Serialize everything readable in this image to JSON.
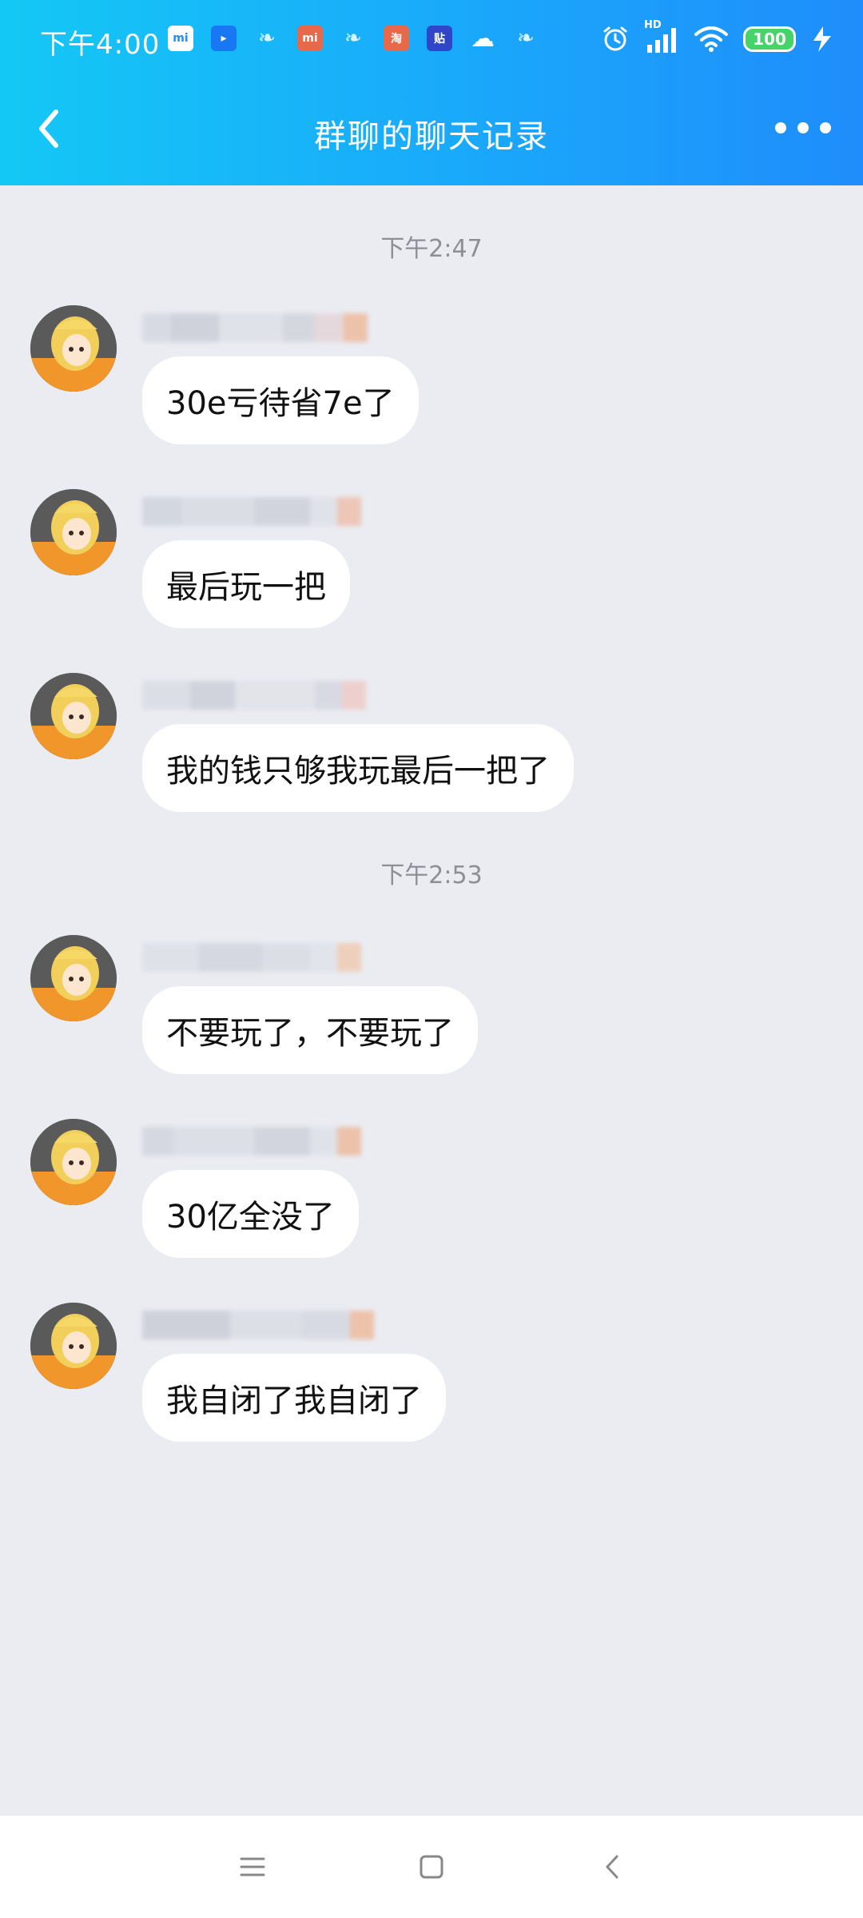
{
  "status_bar": {
    "time": "下午4:00",
    "app_icons": [
      {
        "name": "mi-store-icon",
        "label": "mi"
      },
      {
        "name": "bilibili-icon",
        "label": "▸"
      },
      {
        "name": "leaf-icon-1",
        "label": "❧"
      },
      {
        "name": "mi-app-icon",
        "label": "mi"
      },
      {
        "name": "leaf-icon-2",
        "label": "❧"
      },
      {
        "name": "taobao-icon",
        "label": "淘"
      },
      {
        "name": "tieba-icon",
        "label": "贴"
      },
      {
        "name": "cloud-icon",
        "label": "☁"
      },
      {
        "name": "leaf-icon-3",
        "label": "❧"
      }
    ],
    "network_label": "HD",
    "battery_level": "100"
  },
  "header": {
    "title": "群聊的聊天记录"
  },
  "chat": {
    "groups": [
      {
        "timestamp": "下午2:47",
        "messages": [
          {
            "text": "30e亏待省7e了"
          },
          {
            "text": "最后玩一把"
          },
          {
            "text": "我的钱只够我玩最后一把了"
          }
        ]
      },
      {
        "timestamp": "下午2:53",
        "messages": [
          {
            "text": "不要玩了，不要玩了"
          },
          {
            "text": "30亿全没了"
          },
          {
            "text": "我自闭了我自闭了"
          }
        ]
      }
    ]
  },
  "colors": {
    "header_gradient_start": "#14c8f5",
    "header_gradient_end": "#1f8dfb",
    "chat_background": "#eaecf2",
    "bubble": "#ffffff",
    "timestamp_text": "#8c8f96"
  }
}
